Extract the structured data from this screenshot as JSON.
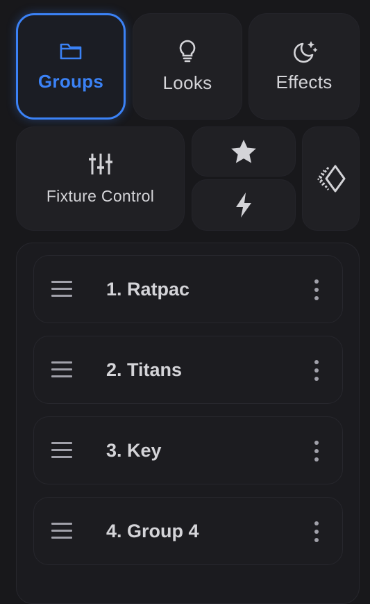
{
  "tabs": {
    "groups": {
      "label": "Groups",
      "icon": "folder-icon",
      "active": true
    },
    "looks": {
      "label": "Looks",
      "icon": "lightbulb-icon"
    },
    "effects": {
      "label": "Effects",
      "icon": "moon-stars-icon"
    },
    "fixture_control": {
      "label": "Fixture Control",
      "icon": "sliders-icon"
    },
    "favorites": {
      "icon": "star-icon"
    },
    "flash": {
      "icon": "lightning-icon"
    },
    "brand": {
      "icon": "brand-logo-icon"
    }
  },
  "colors": {
    "accent": "#3b82f6",
    "background": "#18181b",
    "tile": "#202024",
    "text": "#d4d4d8"
  },
  "groups_list": [
    {
      "name": "1. Ratpac"
    },
    {
      "name": "2. Titans"
    },
    {
      "name": "3. Key"
    },
    {
      "name": "4. Group 4"
    }
  ]
}
